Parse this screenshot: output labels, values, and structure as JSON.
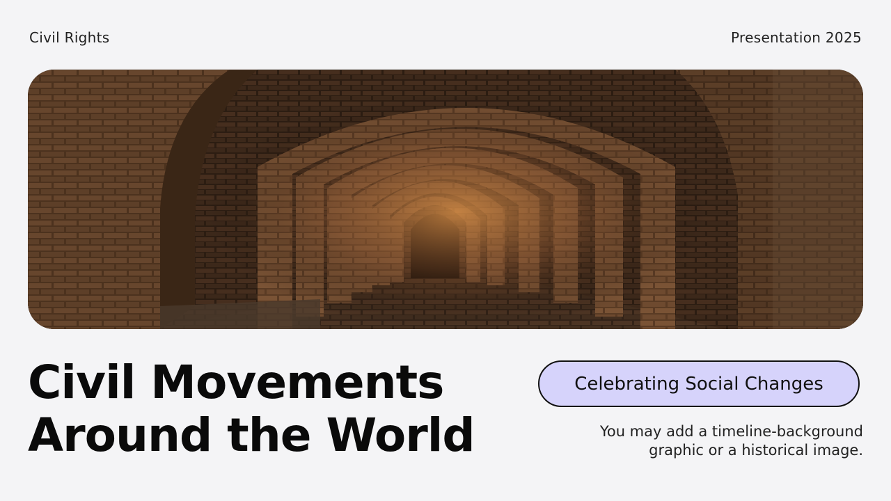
{
  "header": {
    "left_label": "Civil Rights",
    "right_label": "Presentation 2025"
  },
  "hero": {
    "image_subject": "brick-archway-tunnel"
  },
  "title": {
    "line1": "Civil Movements",
    "line2": "Around the World"
  },
  "tagline": "Celebrating Social Changes",
  "note": {
    "line1": "You may add a timeline-background",
    "line2": "graphic or a historical image."
  },
  "colors": {
    "background": "#f4f4f6",
    "pill_fill": "#d6d3fb",
    "text": "#111111"
  }
}
